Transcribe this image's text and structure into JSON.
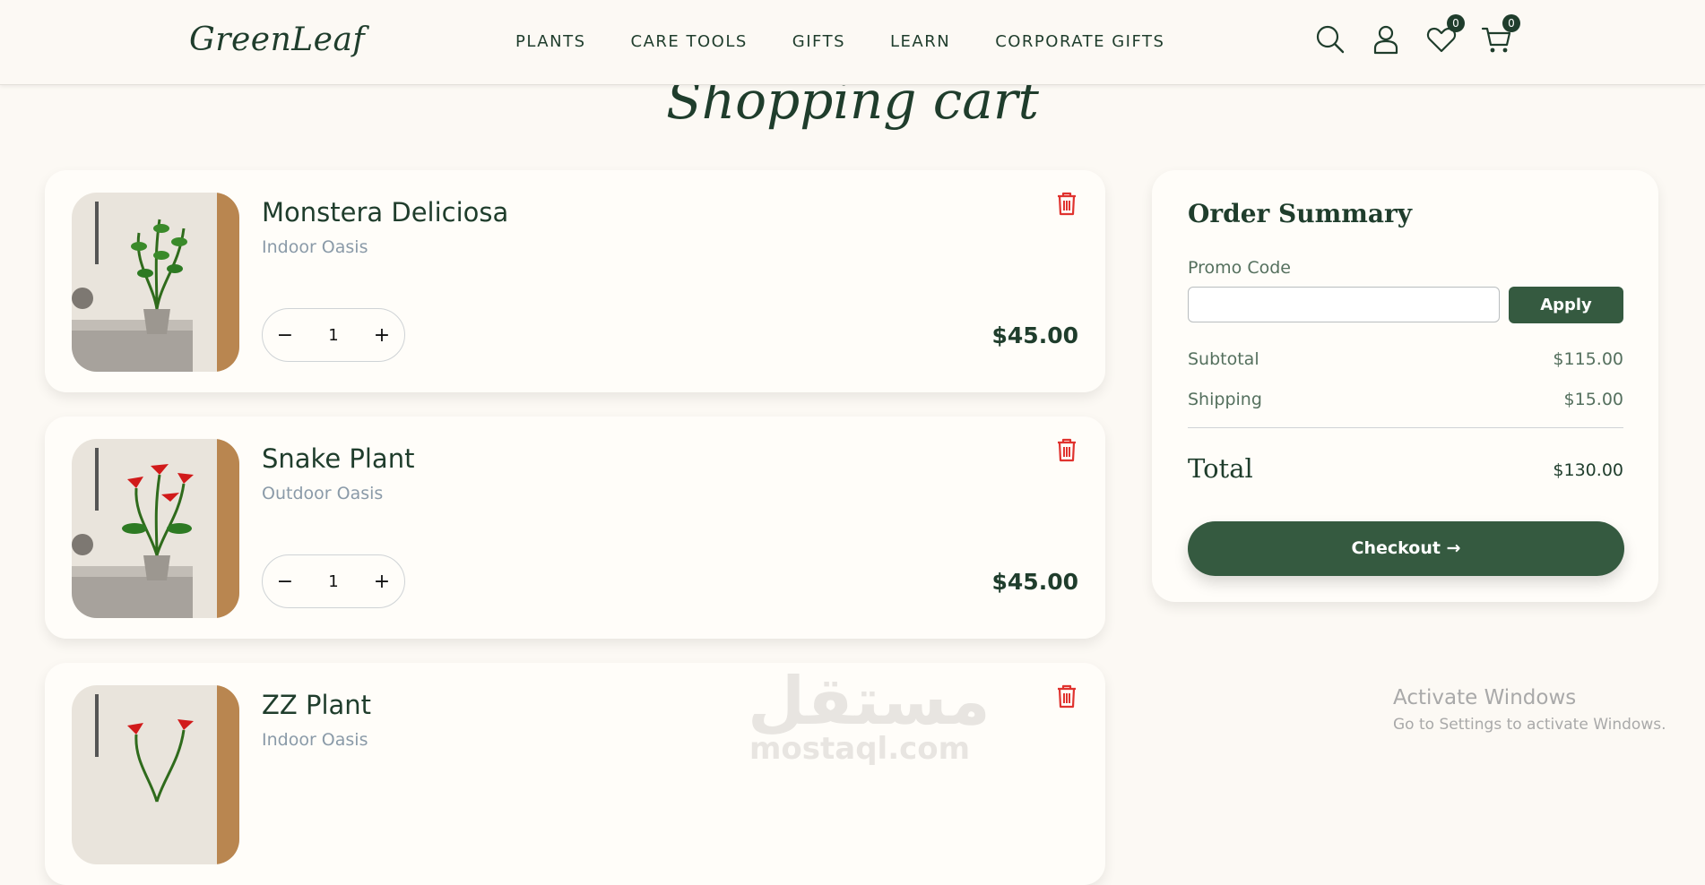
{
  "header": {
    "logo": "GreenLeaf",
    "nav": [
      "PLANTS",
      "CARE TOOLS",
      "GIFTS",
      "LEARN",
      "CORPORATE GIFTS"
    ],
    "wishlist_count": "0",
    "cart_count": "0"
  },
  "page": {
    "title": "Shopping cart"
  },
  "cart_items": [
    {
      "name": "Monstera Deliciosa",
      "category": "Indoor Oasis",
      "quantity": "1",
      "price": "$45.00",
      "flower_color": "#1f7a2b"
    },
    {
      "name": "Snake Plant",
      "category": "Outdoor Oasis",
      "quantity": "1",
      "price": "$45.00",
      "flower_color": "#d11a1a"
    },
    {
      "name": "ZZ Plant",
      "category": "Indoor Oasis",
      "quantity": "",
      "price": "",
      "flower_color": "#d11a1a"
    }
  ],
  "summary": {
    "title": "Order Summary",
    "promo_label": "Promo Code",
    "promo_value": "",
    "apply_label": "Apply",
    "subtotal_label": "Subtotal",
    "subtotal_value": "$115.00",
    "shipping_label": "Shipping",
    "shipping_value": "$15.00",
    "total_label": "Total",
    "total_value": "$130.00",
    "checkout_label": "Checkout →"
  },
  "watermark": {
    "arabic": "مستقل",
    "latin": "mostaql.com"
  },
  "os_notice": {
    "title": "Activate Windows",
    "subtitle": "Go to Settings to activate Windows."
  },
  "colors": {
    "brand_green": "#355a40",
    "text_dark": "#1f3d2c",
    "danger_red": "#e0332f",
    "background": "#fcf9f4"
  }
}
